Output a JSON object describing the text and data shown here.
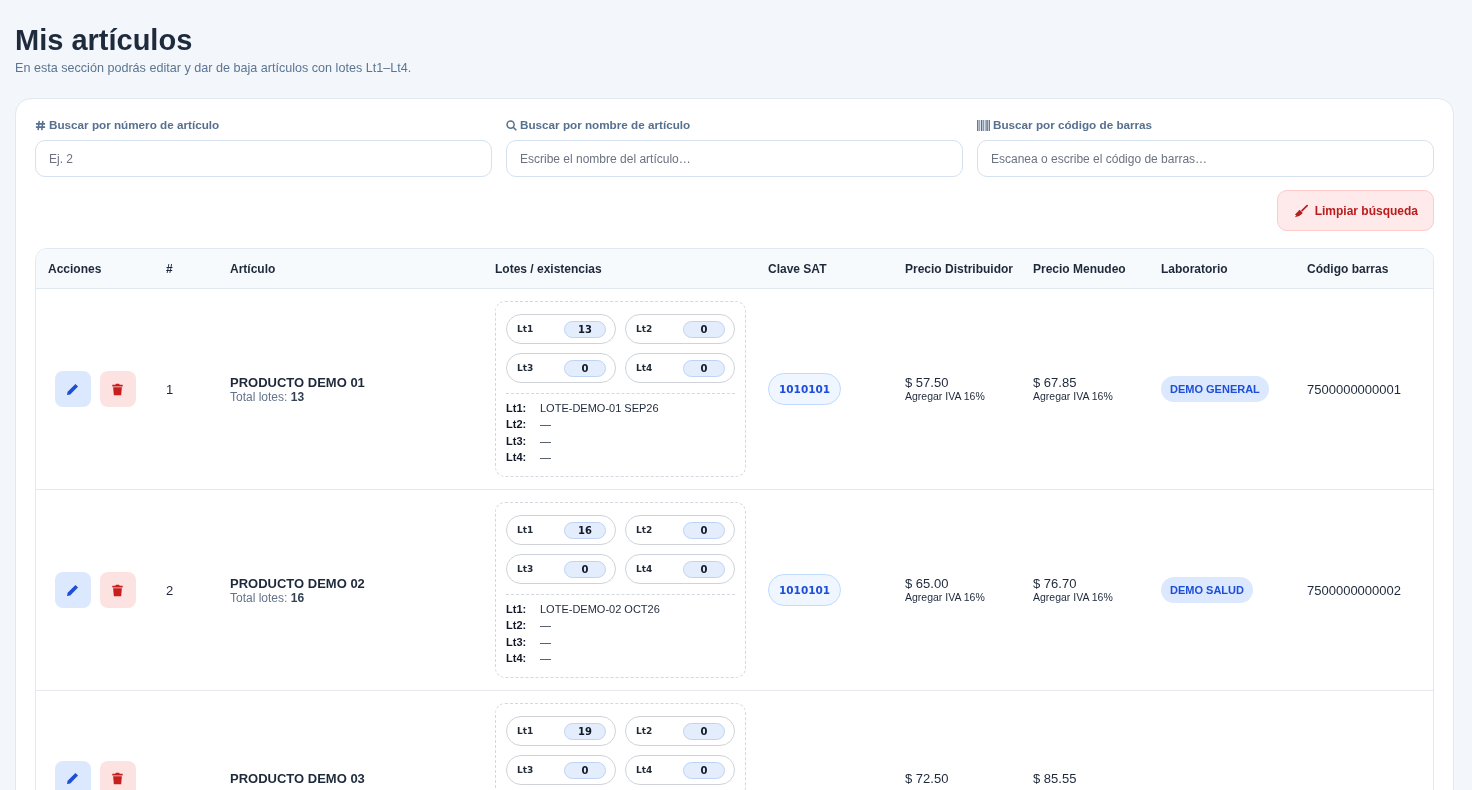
{
  "page": {
    "title": "Mis artículos",
    "subtitle": "En esta sección podrás editar y dar de baja artículos con lotes Lt1–Lt4."
  },
  "search_fields": [
    {
      "kind": "number",
      "label": "Buscar por número de artículo",
      "placeholder": "Ej. 2"
    },
    {
      "kind": "name",
      "label": "Buscar por nombre de artículo",
      "placeholder": "Escribe el nombre del artículo…"
    },
    {
      "kind": "barcode",
      "label": "Buscar por código de barras",
      "placeholder": "Escanea o escribe el código de barras…"
    }
  ],
  "clear_button": {
    "label": "Limpiar búsqueda"
  },
  "table": {
    "columns": [
      "Acciones",
      "#",
      "Artículo",
      "Lotes / existencias",
      "Clave SAT",
      "Precio Distribuidor",
      "Precio Menudeo",
      "Laboratorio",
      "Código barras"
    ],
    "rows": [
      {
        "number": "1",
        "name": "PRODUCTO DEMO 01",
        "total": "Total lotes: **13**",
        "lots": [
          {
            "label": "Lt1",
            "stock": "13"
          },
          {
            "label": "Lt2",
            "stock": "0"
          },
          {
            "label": "Lt3",
            "stock": "0"
          },
          {
            "label": "Lt4",
            "stock": "0"
          }
        ],
        "lot_details": [
          {
            "label": "Lt1:",
            "value": "LOTE-DEMO-01 SEP26"
          },
          {
            "label": "Lt2:",
            "value": "—"
          },
          {
            "label": "Lt3:",
            "value": "—"
          },
          {
            "label": "Lt4:",
            "value": "—"
          }
        ],
        "clave_sat": "1010101",
        "distributor_price": {
          "amount": "$ 57.50",
          "note": "Agregar IVA 16%"
        },
        "retail_price": {
          "amount": "$ 67.85",
          "note": "Agregar IVA 16%"
        },
        "laboratory": "DEMO GENERAL",
        "barcode": "7500000000001"
      },
      {
        "number": "2",
        "name": "PRODUCTO DEMO 02",
        "total": "Total lotes: **16**",
        "lots": [
          {
            "label": "Lt1",
            "stock": "16"
          },
          {
            "label": "Lt2",
            "stock": "0"
          },
          {
            "label": "Lt3",
            "stock": "0"
          },
          {
            "label": "Lt4",
            "stock": "0"
          }
        ],
        "lot_details": [
          {
            "label": "Lt1:",
            "value": "LOTE-DEMO-02 OCT26"
          },
          {
            "label": "Lt2:",
            "value": "—"
          },
          {
            "label": "Lt3:",
            "value": "—"
          },
          {
            "label": "Lt4:",
            "value": "—"
          }
        ],
        "clave_sat": "1010101",
        "distributor_price": {
          "amount": "$ 65.00",
          "note": "Agregar IVA 16%"
        },
        "retail_price": {
          "amount": "$ 76.70",
          "note": "Agregar IVA 16%"
        },
        "laboratory": "DEMO SALUD",
        "barcode": "7500000000002"
      },
      {
        "name": "PRODUCTO DEMO 03",
        "lots": [
          {
            "label": "Lt1",
            "stock": "19"
          },
          {
            "label": "Lt2",
            "stock": "0"
          },
          {
            "label": "Lt3",
            "stock": "0"
          },
          {
            "label": "Lt4",
            "stock": "0"
          }
        ],
        "distributor_price": {
          "amount": "$ 72.50"
        },
        "retail_price": {
          "amount": "$ 85.55"
        }
      }
    ]
  }
}
